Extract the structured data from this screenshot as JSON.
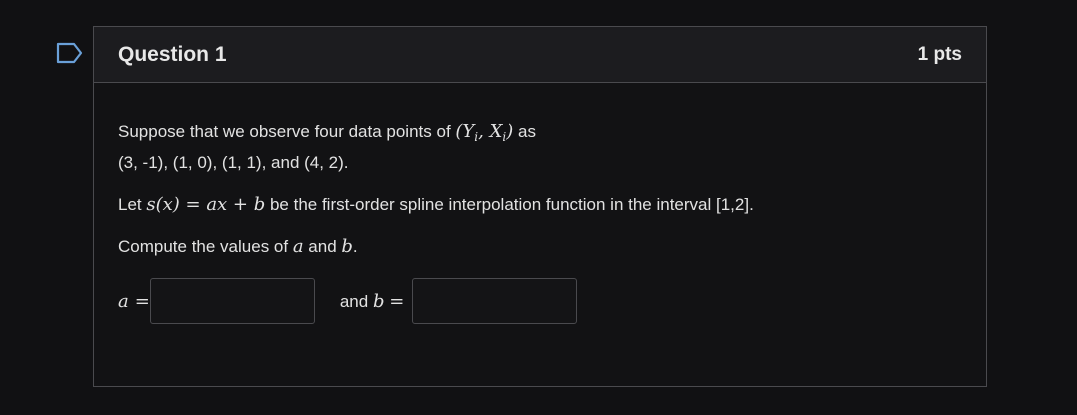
{
  "question": {
    "title": "Question 1",
    "points": "1 pts",
    "bookmark_icon": "bookmark-flag-icon"
  },
  "body": {
    "p1_text1": "Suppose that we observe four  data points of ",
    "p1_math": "(Y",
    "p1_sub1": "i",
    "p1_mid": ", X",
    "p1_sub2": "i",
    "p1_close": ")",
    "p1_text2": " as",
    "p1_line2": "(3,  -1),   (1,  0),   (1, 1), and  (4, 2).",
    "p2_text1": "Let ",
    "p2_math": "s(x) = ax + b",
    "p2_text2": " be the first-order spline interpolation function in the interval [1,2].",
    "p3_text1": "Compute the values of  ",
    "p3_math_a": "a",
    "p3_text2": " and ",
    "p3_math_b": "b",
    "p3_text3": "."
  },
  "answers": {
    "a_label": "a",
    "eq": "=",
    "a_value": "",
    "and_text": "and",
    "b_label": "b",
    "b_value": ""
  },
  "colors": {
    "background": "#111113",
    "header": "#1c1c1f",
    "border": "#4a4a4e",
    "text": "#e2e2e2"
  }
}
